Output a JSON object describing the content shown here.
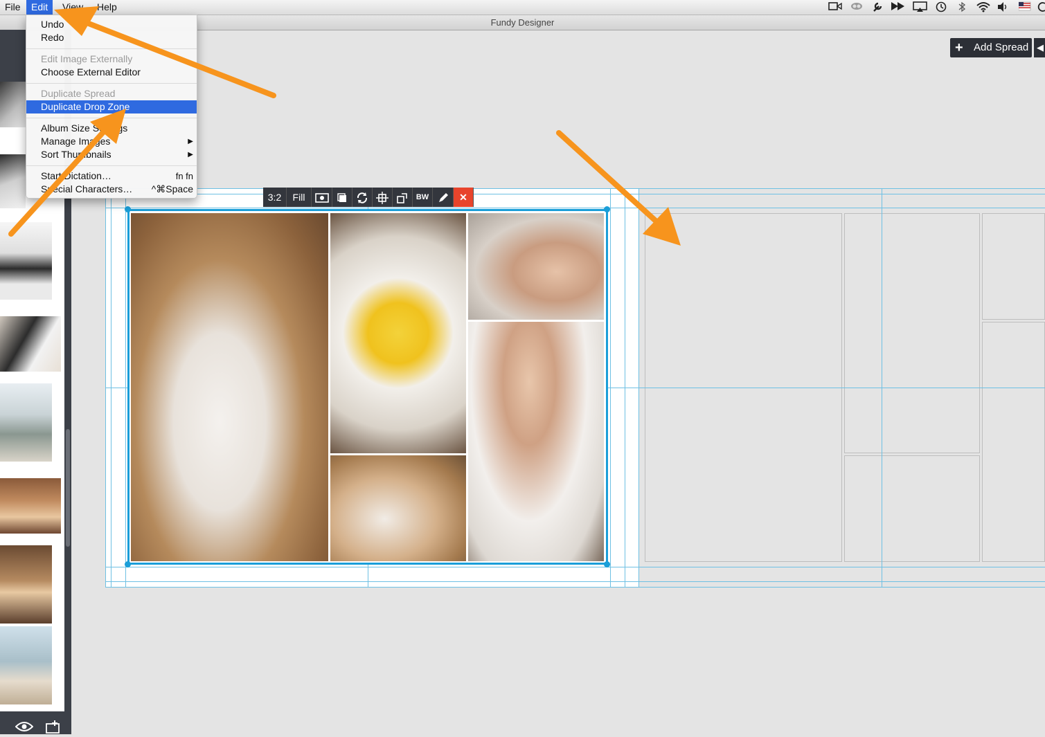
{
  "menubar": {
    "items": [
      "File",
      "Edit",
      "View",
      "Help"
    ],
    "status_icons": [
      "video-icon",
      "creative-cloud-icon",
      "wrench-icon",
      "fast-forward-icon",
      "airplay-icon",
      "time-machine-icon",
      "bluetooth-icon",
      "wifi-icon",
      "volume-icon",
      "flag-icon"
    ]
  },
  "window": {
    "title": "Fundy Designer"
  },
  "toolbar": {
    "add_spread": "Add Spread",
    "add_icon": "+"
  },
  "edit_menu": {
    "undo": "Undo",
    "redo": "Redo",
    "edit_image_externally": "Edit Image Externally",
    "choose_external_editor": "Choose External Editor",
    "duplicate_spread": "Duplicate Spread",
    "duplicate_drop_zone": "Duplicate Drop Zone",
    "album_size_settings": "Album Size Settings",
    "manage_images": "Manage Images",
    "sort_thumbnails": "Sort Thumbnails",
    "start_dictation": "Start Dictation…",
    "start_dictation_shortcut": "fn fn",
    "special_characters": "Special Characters…",
    "special_characters_shortcut": "^⌘Space",
    "submenu_arrow": "▶"
  },
  "image_toolbar": {
    "ratio": "3:2",
    "fill": "Fill",
    "bw": "BW",
    "delete": "✕"
  },
  "colors": {
    "accent": "#1a9ed8",
    "menu_highlight": "#2f6ae0",
    "arrow": "#f7941d",
    "delete": "#e8442c"
  }
}
